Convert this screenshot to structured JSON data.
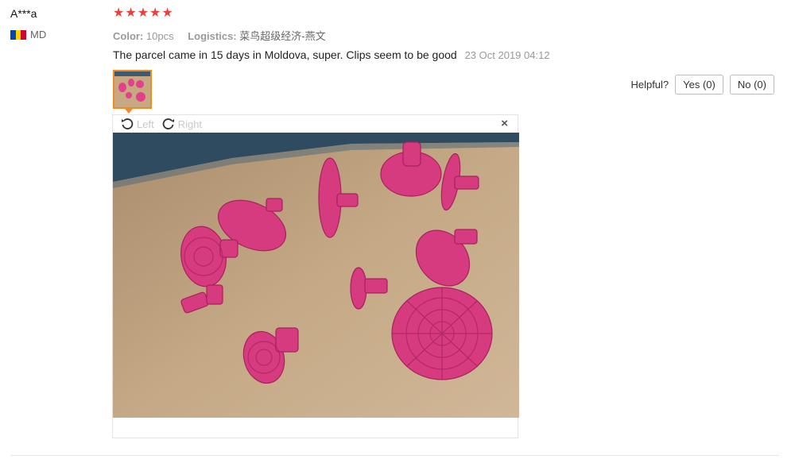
{
  "review": {
    "user": "A***a",
    "country_code": "MD",
    "rating": 5,
    "color_label": "Color:",
    "color_value": "10pcs",
    "logistics_label": "Logistics:",
    "logistics_value": "菜鸟超级经济-燕文",
    "text": "The parcel came in 15 days in Moldova, super. Clips seem to be good",
    "date": "23 Oct 2019 04:12"
  },
  "viewer": {
    "rotate_left": "Left",
    "rotate_right": "Right",
    "close": "×"
  },
  "helpful": {
    "label": "Helpful?",
    "yes": "Yes (0)",
    "no": "No (0)"
  },
  "colors": {
    "star": "#e8403a",
    "thumb_border": "#f08a24",
    "flag": [
      "#0046ae",
      "#ffd200",
      "#cc092f"
    ]
  }
}
